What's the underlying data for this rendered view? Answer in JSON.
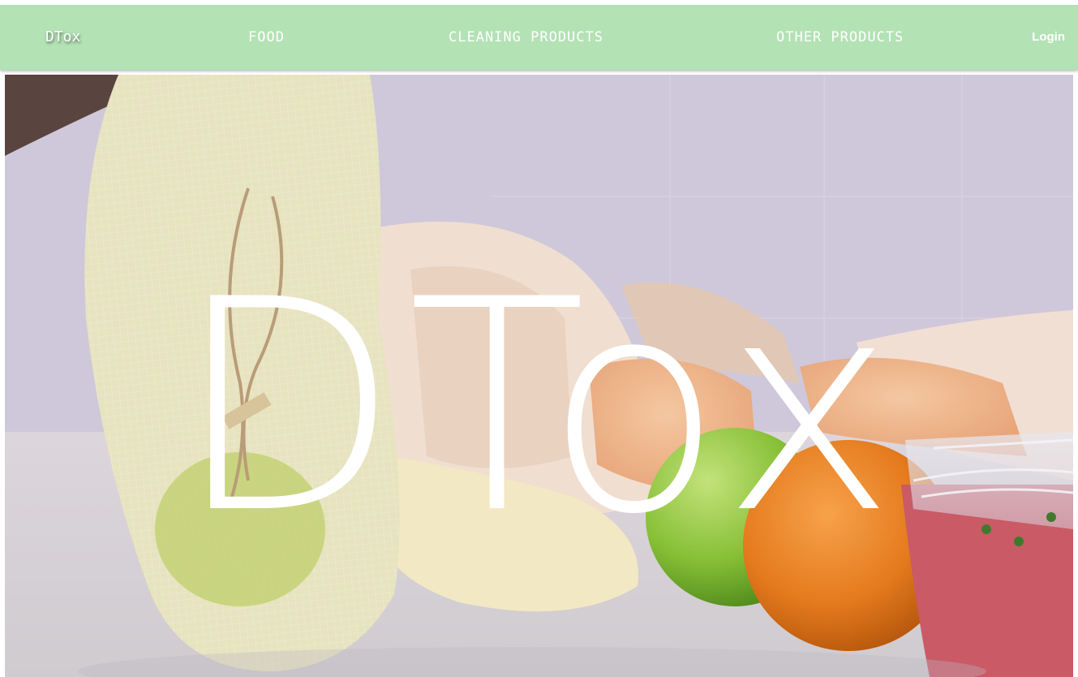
{
  "colors": {
    "navbar_bg": "#b3e2b5",
    "nav_text": "#ffffff",
    "hero_title": "#ffffff"
  },
  "navbar": {
    "brand": "DTox",
    "links": {
      "food": "FOOD",
      "cleaning": "CLEANING PRODUCTS",
      "other": "OTHER PRODUCTS"
    },
    "login": "Login"
  },
  "hero": {
    "title": "DTox"
  }
}
